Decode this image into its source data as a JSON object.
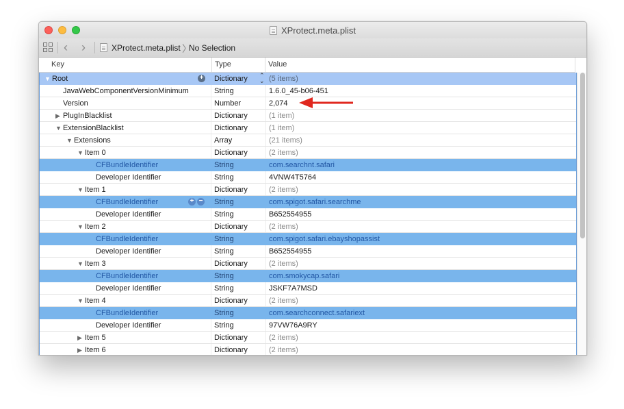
{
  "window": {
    "title": "XProtect.meta.plist"
  },
  "toolbar": {
    "breadcrumb_file": "XProtect.meta.plist",
    "breadcrumb_selection": "No Selection",
    "back_arrow": "‹",
    "forward_arrow": "›",
    "breadcrumb_separator": "〉"
  },
  "columns": {
    "key": "Key",
    "type": "Type",
    "value": "Value"
  },
  "rows": [
    {
      "key": "Root",
      "type": "Dictionary",
      "value": "(5 items)"
    },
    {
      "key": "JavaWebComponentVersionMinimum",
      "type": "String",
      "value": "1.6.0_45-b06-451"
    },
    {
      "key": "Version",
      "type": "Number",
      "value": "2,074"
    },
    {
      "key": "PlugInBlacklist",
      "type": "Dictionary",
      "value": "(1 item)"
    },
    {
      "key": "ExtensionBlacklist",
      "type": "Dictionary",
      "value": "(1 item)"
    },
    {
      "key": "Extensions",
      "type": "Array",
      "value": "(21 items)"
    },
    {
      "key": "Item 0",
      "type": "Dictionary",
      "value": "(2 items)"
    },
    {
      "key": "CFBundleIdentifier",
      "type": "String",
      "value": "com.searchnt.safari"
    },
    {
      "key": "Developer Identifier",
      "type": "String",
      "value": "4VNW4T5764"
    },
    {
      "key": "Item 1",
      "type": "Dictionary",
      "value": "(2 items)"
    },
    {
      "key": "CFBundleIdentifier",
      "type": "String",
      "value": "com.spigot.safari.searchme"
    },
    {
      "key": "Developer Identifier",
      "type": "String",
      "value": "B652554955"
    },
    {
      "key": "Item 2",
      "type": "Dictionary",
      "value": "(2 items)"
    },
    {
      "key": "CFBundleIdentifier",
      "type": "String",
      "value": "com.spigot.safari.ebayshopassist"
    },
    {
      "key": "Developer Identifier",
      "type": "String",
      "value": "B652554955"
    },
    {
      "key": "Item 3",
      "type": "Dictionary",
      "value": "(2 items)"
    },
    {
      "key": "CFBundleIdentifier",
      "type": "String",
      "value": "com.smokycap.safari"
    },
    {
      "key": "Developer Identifier",
      "type": "String",
      "value": "JSKF7A7MSD"
    },
    {
      "key": "Item 4",
      "type": "Dictionary",
      "value": "(2 items)"
    },
    {
      "key": "CFBundleIdentifier",
      "type": "String",
      "value": "com.searchconnect.safariext"
    },
    {
      "key": "Developer Identifier",
      "type": "String",
      "value": "97VW76A9RY"
    },
    {
      "key": "Item 5",
      "type": "Dictionary",
      "value": "(2 items)"
    },
    {
      "key": "Item 6",
      "type": "Dictionary",
      "value": "(2 items)"
    }
  ],
  "glyphs": {
    "expanded": "▼",
    "collapsed": "▶",
    "add": "+",
    "remove": "−",
    "stepper_up": "⌃",
    "stepper_down": "⌄"
  },
  "colors": {
    "selection": "#a7c7f5",
    "highlight_row": "#79b5ec",
    "annotation_arrow": "#e0281f"
  }
}
